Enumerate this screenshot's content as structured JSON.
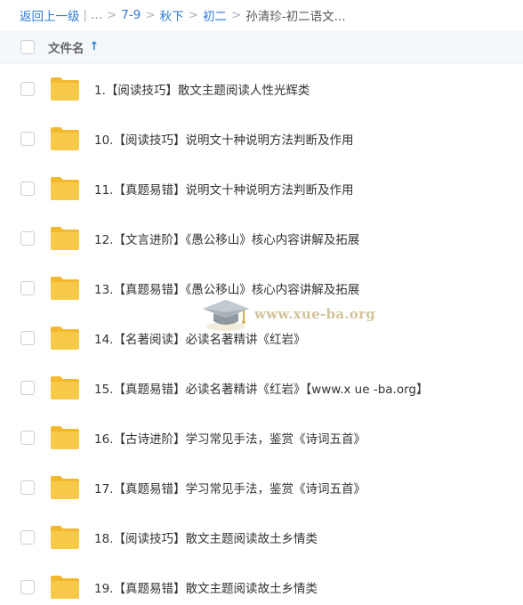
{
  "breadcrumb": {
    "back": "返回上一级",
    "pipe": "|",
    "ellipsis": "...",
    "sep": ">",
    "items": [
      "7-9",
      "秋下",
      "初二"
    ],
    "current": "孙清珍-初二语文..."
  },
  "header": {
    "label": "文件名",
    "sort_icon": "↑"
  },
  "files": [
    "1.【阅读技巧】散文主题阅读人性光辉类",
    "10.【阅读技巧】说明文十种说明方法判断及作用",
    "11.【真题易错】说明文十种说明方法判断及作用",
    "12.【文言进阶】《愚公移山》核心内容讲解及拓展",
    "13.【真题易错】《愚公移山》核心内容讲解及拓展",
    "14.【名著阅读】必读名著精讲《红岩》",
    "15.【真题易错】必读名著精讲《红岩》【www.x ue -ba.org】",
    "16.【古诗进阶】学习常见手法，鉴赏《诗词五首》",
    "17.【真题易错】学习常见手法，鉴赏《诗词五首》",
    "18.【阅读技巧】散文主题阅读故土乡情类",
    "19.【真题易错】散文主题阅读故土乡情类"
  ],
  "watermark": "www.xue-ba.org",
  "colors": {
    "link": "#2e7ad6",
    "folder": "#f7c948",
    "folder_tab": "#f2b92f",
    "header_bg": "#f4f7fb"
  }
}
